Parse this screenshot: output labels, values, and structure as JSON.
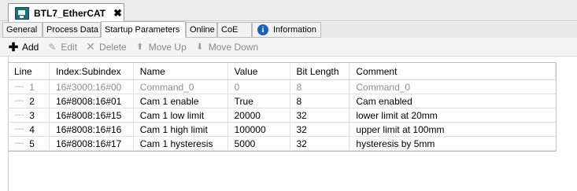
{
  "document_tab": {
    "title": "BTL7_EtherCAT",
    "close_glyph": "✖",
    "icon": "ethercat-device-icon"
  },
  "editor_tabs": [
    {
      "label": "General",
      "active": false
    },
    {
      "label": "Process Data",
      "active": false
    },
    {
      "label": "Startup Parameters",
      "active": true
    },
    {
      "label": "Online",
      "active": false
    },
    {
      "label": "CoE",
      "active": false
    },
    {
      "label": "Information",
      "active": false,
      "icon": "info-icon"
    }
  ],
  "toolbar": {
    "add": "Add",
    "edit": "Edit",
    "delete": "Delete",
    "move_up": "Move Up",
    "move_down": "Move Down"
  },
  "table": {
    "columns": [
      "Line",
      "Index:Subindex",
      "Name",
      "Value",
      "Bit Length",
      "Comment"
    ],
    "rows": [
      {
        "line": "1",
        "index": "16#3000:16#00",
        "name": "Command_0",
        "value": "0",
        "bits": "8",
        "comment": "Command_0",
        "dimmed": true
      },
      {
        "line": "2",
        "index": "16#8008:16#01",
        "name": "Cam 1 enable",
        "value": "True",
        "bits": "8",
        "comment": "Cam enabled",
        "dimmed": false
      },
      {
        "line": "3",
        "index": "16#8008:16#15",
        "name": "Cam 1 low limit",
        "value": "20000",
        "bits": "32",
        "comment": "lower limit at 20mm",
        "dimmed": false
      },
      {
        "line": "4",
        "index": "16#8008:16#16",
        "name": "Cam 1 high limit",
        "value": "100000",
        "bits": "32",
        "comment": "upper limit at 100mm",
        "dimmed": false
      },
      {
        "line": "5",
        "index": "16#8008:16#17",
        "name": "Cam 1 hysteresis",
        "value": "5000",
        "bits": "32",
        "comment": "hysteresis by 5mm",
        "dimmed": false
      }
    ]
  }
}
